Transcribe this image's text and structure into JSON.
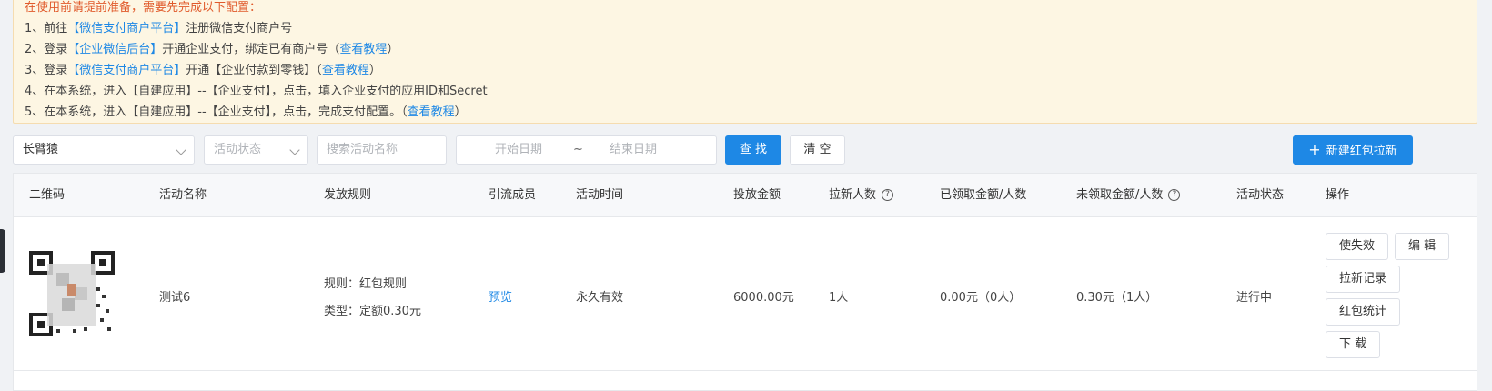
{
  "notice": {
    "header": "在使用前请提前准备，需要先完成以下配置：",
    "lines": [
      {
        "prefix": "1、前往",
        "link1": "【微信支付商户平台】",
        "mid": "注册微信支付商户号",
        "link2": "",
        "suffix": ""
      },
      {
        "prefix": "2、登录",
        "link1": "【企业微信后台】",
        "mid": "开通企业支付，绑定已有商户号（",
        "link2": "查看教程",
        "suffix": "）"
      },
      {
        "prefix": "3、登录",
        "link1": "【微信支付商户平台】",
        "mid": "开通【企业付款到零钱】（",
        "link2": "查看教程",
        "suffix": "）"
      },
      {
        "prefix": "4、在本系统，进入【自建应用】--【企业支付】，点击，填入企业支付的应用ID和Secret",
        "link1": "",
        "mid": "",
        "link2": "",
        "suffix": ""
      },
      {
        "prefix": "5、在本系统，进入【自建应用】--【企业支付】，点击，完成支付配置。（",
        "link1": "",
        "mid": "",
        "link2": "查看教程",
        "suffix": "）"
      }
    ]
  },
  "filters": {
    "account_value": "长臂猿",
    "status_placeholder": "活动状态",
    "search_placeholder": "搜索活动名称",
    "start_placeholder": "开始日期",
    "range_sep": "~",
    "end_placeholder": "结束日期",
    "search_btn": "查 找",
    "clear_btn": "清 空",
    "new_btn": "新建红包拉新"
  },
  "table": {
    "headers": {
      "qrcode": "二维码",
      "name": "活动名称",
      "rule": "发放规则",
      "member": "引流成员",
      "time": "活动时间",
      "amount": "投放金额",
      "invited": "拉新人数",
      "claimed": "已领取金额/人数",
      "unclaimed": "未领取金额/人数",
      "status": "活动状态",
      "ops": "操作"
    },
    "rows": [
      {
        "name": "测试6",
        "rule_line1": "规则：红包规则",
        "rule_line2": "类型：定额0.30元",
        "member_link": "预览",
        "time": "永久有效",
        "amount": "6000.00元",
        "invited": "1人",
        "claimed": "0.00元（0人）",
        "unclaimed": "0.30元（1人）",
        "status": "进行中",
        "ops": {
          "disable": "使失效",
          "edit": "编 辑",
          "records": "拉新记录",
          "stats": "红包统计",
          "download": "下 载"
        }
      }
    ]
  },
  "colors": {
    "primary": "#1e88e5",
    "notice_bg": "#fdf6e3",
    "notice_head": "#e05a2b"
  }
}
